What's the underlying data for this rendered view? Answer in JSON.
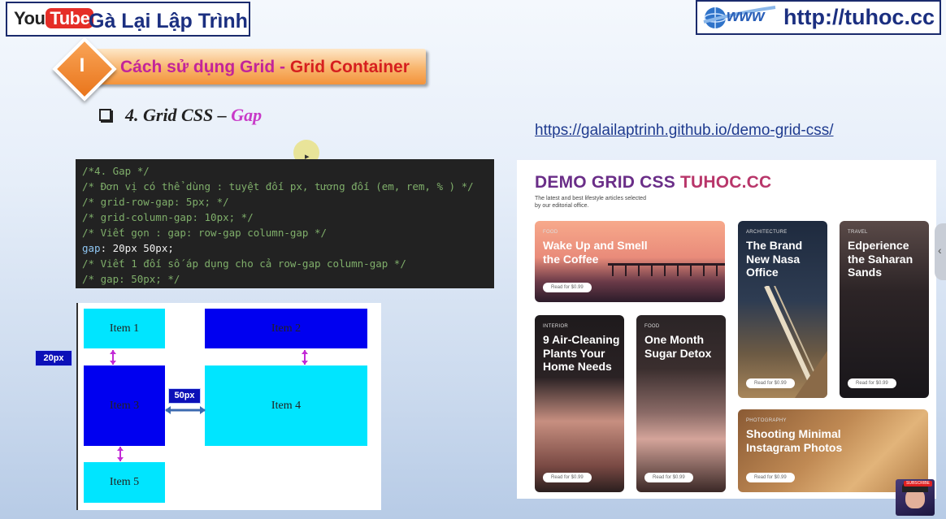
{
  "header": {
    "youtube_you": "You",
    "youtube_tube": "Tube",
    "channel_name": "Gà Lại Lập Trình",
    "www_text": "www",
    "site_url": "http://tuhoc.cc"
  },
  "section": {
    "number": "I",
    "title_part1": "Cách sử dụng Grid - ",
    "title_part2": "Grid Container"
  },
  "subheading": {
    "prefix": "4. Grid CSS – ",
    "highlight": "Gap"
  },
  "demo_link": "https://galailaptrinh.github.io/demo-grid-css/",
  "code": {
    "lines": [
      "/*4. Gap */",
      "/* Đơn vị có thể dùng : tuyệt đối px, tương đối (em, rem, % ) */",
      "/* grid-row-gap: 5px; */",
      "/* grid-column-gap: 10px; */",
      "/* Viết gọn : gap: row-gap column-gap */",
      "/* Viết 1 đối số áp dụng cho cả row-gap column-gap */",
      "/* gap: 50px; */"
    ],
    "prop": "gap",
    "value": ": 20px 50px;"
  },
  "diagram": {
    "items": [
      "Item 1",
      "Item 2",
      "Item 3",
      "Item 4",
      "Item 5"
    ],
    "row_gap_label": "20px",
    "col_gap_label": "50px",
    "colors": {
      "cyan": "#00e5ff",
      "blue": "#0000f0",
      "arrow_v": "#c22ad6",
      "arrow_h": "#3c6ab0"
    }
  },
  "demo": {
    "title_part1": "DEMO GRID CSS ",
    "title_part2": "TUHOC.CC",
    "subtitle": "The latest and best lifestyle articles selected by our editorial office.",
    "cards": [
      {
        "category": "FOOD",
        "title": "Wake Up and Smell the Coffee",
        "button": "Read for $0.99"
      },
      {
        "category": "ARCHITECTURE",
        "title": "The Brand New Nasa Office",
        "button": "Read for $0.99"
      },
      {
        "category": "TRAVEL",
        "title": "Edperience the Saharan Sands",
        "button": "Read for $0.99"
      },
      {
        "category": "INTERIOR",
        "title": "9 Air-Cleaning Plants Your Home Needs",
        "button": "Read for $0.99"
      },
      {
        "category": "FOOD",
        "title": "One Month Sugar Detox",
        "button": "Read for $0.99"
      },
      {
        "category": "PHOTOGRAPHY",
        "title": "Shooting Minimal Instagram Photos",
        "button": "Read for $0.99"
      }
    ]
  },
  "avatar_badge": "SUBSCRIBE"
}
